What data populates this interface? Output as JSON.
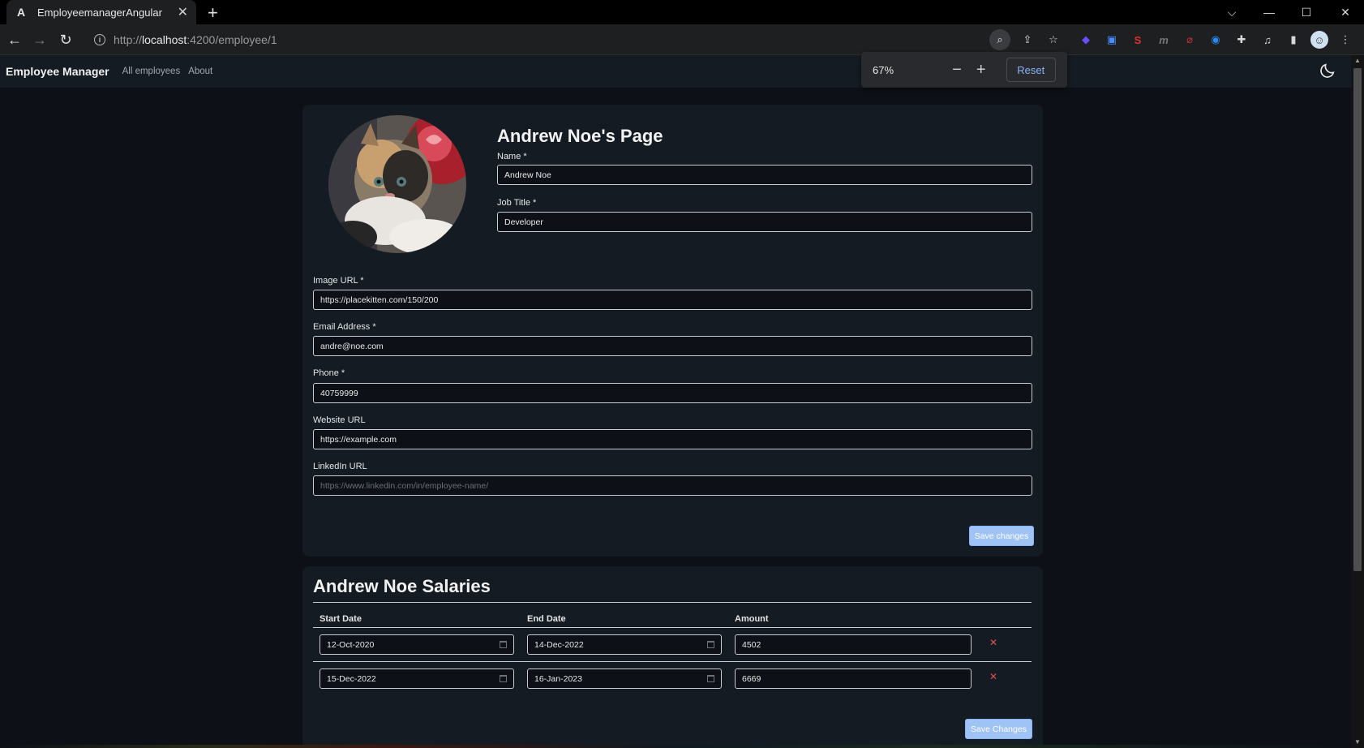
{
  "browser": {
    "tab_title": "EmployeemanagerAngular",
    "url_prefix": "http://",
    "url_host": "localhost",
    "url_rest": ":4200/employee/1",
    "zoom": {
      "percent": "67%",
      "reset_label": "Reset"
    }
  },
  "nav": {
    "brand": "Employee Manager",
    "links": [
      "All employees",
      "About"
    ]
  },
  "employee": {
    "page_title": "Andrew Noe's Page",
    "fields": {
      "name": {
        "label": "Name *",
        "value": "Andrew Noe"
      },
      "job_title": {
        "label": "Job Title *",
        "value": "Developer"
      },
      "image_url": {
        "label": "Image URL *",
        "value": "https://placekitten.com/150/200"
      },
      "email": {
        "label": "Email Address *",
        "value": "andre@noe.com"
      },
      "phone": {
        "label": "Phone *",
        "value": "40759999"
      },
      "website": {
        "label": "Website URL",
        "value": "https://example.com"
      },
      "linkedin": {
        "label": "LinkedIn URL",
        "value": "",
        "placeholder": "https://www.linkedin.com/in/employee-name/"
      }
    },
    "save_label": "Save changes"
  },
  "salaries": {
    "title": "Andrew Noe Salaries",
    "headers": [
      "Start Date",
      "End Date",
      "Amount"
    ],
    "rows": [
      {
        "start": "12-Oct-2020",
        "end": "14-Dec-2022",
        "amount": "4502",
        "delete": "✕"
      },
      {
        "start": "15-Dec-2022",
        "end": "16-Jan-2023",
        "amount": "6669",
        "delete": "✕"
      }
    ],
    "save_label": "Save Changes"
  },
  "colors": {
    "page_bg": "#0d1117",
    "card_bg": "#151b22",
    "primary_button": "#9fc3f5",
    "delete_icon": "#e05050"
  }
}
